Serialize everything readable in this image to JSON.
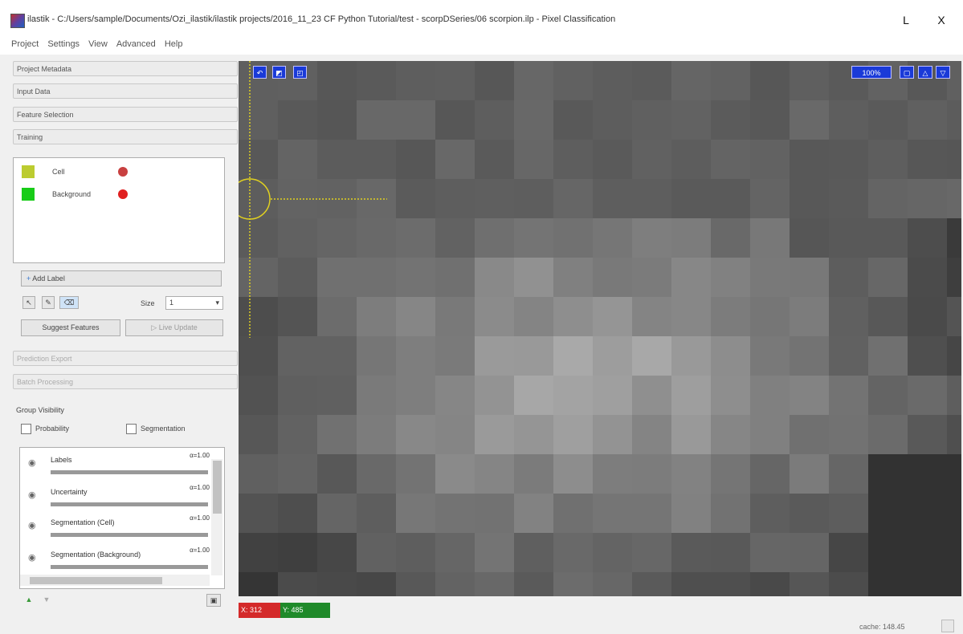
{
  "window": {
    "title": "ilastik - C:/Users/sample/Documents/Ozi_ilastik/ilastik projects/2016_11_23 CF Python Tutorial/test - scorpDSeries/06 scorpion.ilp - Pixel Classification",
    "minimize_label": "L",
    "close_label": "X"
  },
  "menu": [
    "Project",
    "Settings",
    "View",
    "Advanced",
    "Help"
  ],
  "applets": {
    "project_metadata": "Project Metadata",
    "input_data": "Input Data",
    "feature_selection": "Feature Selection",
    "training": "Training",
    "prediction_export": "Prediction Export",
    "batch_processing": "Batch Processing"
  },
  "labels": [
    {
      "name": "Cell",
      "color": "#bccc30",
      "pick_color": "#c84040"
    },
    {
      "name": "Background",
      "color": "#18cc18",
      "pick_color": "#e02020"
    }
  ],
  "training": {
    "add_label": "Add Label",
    "size_label": "Size",
    "size_value": "1",
    "suggest_features": "Suggest Features",
    "live_update": "Live Update"
  },
  "group_visibility": {
    "title": "Group Visibility",
    "probability": "Probability",
    "segmentation": "Segmentation"
  },
  "layers": [
    {
      "name": "Labels",
      "alpha": "α=1.00"
    },
    {
      "name": "Uncertainty",
      "alpha": "α=1.00"
    },
    {
      "name": "Segmentation (Cell)",
      "alpha": "α=1.00"
    },
    {
      "name": "Segmentation (Background)",
      "alpha": "α=1.00"
    }
  ],
  "viewer": {
    "coord_x": "X: 312",
    "coord_y": "Y: 485",
    "zoom_label": "100%"
  },
  "status": {
    "cache_text": "cache: 148.45"
  },
  "colors": {
    "viewer_button": "#1a3ad8",
    "crosshair": "#e0d020",
    "coord_x_bg": "#d42a2a",
    "coord_y_bg": "#1f8a2a"
  }
}
